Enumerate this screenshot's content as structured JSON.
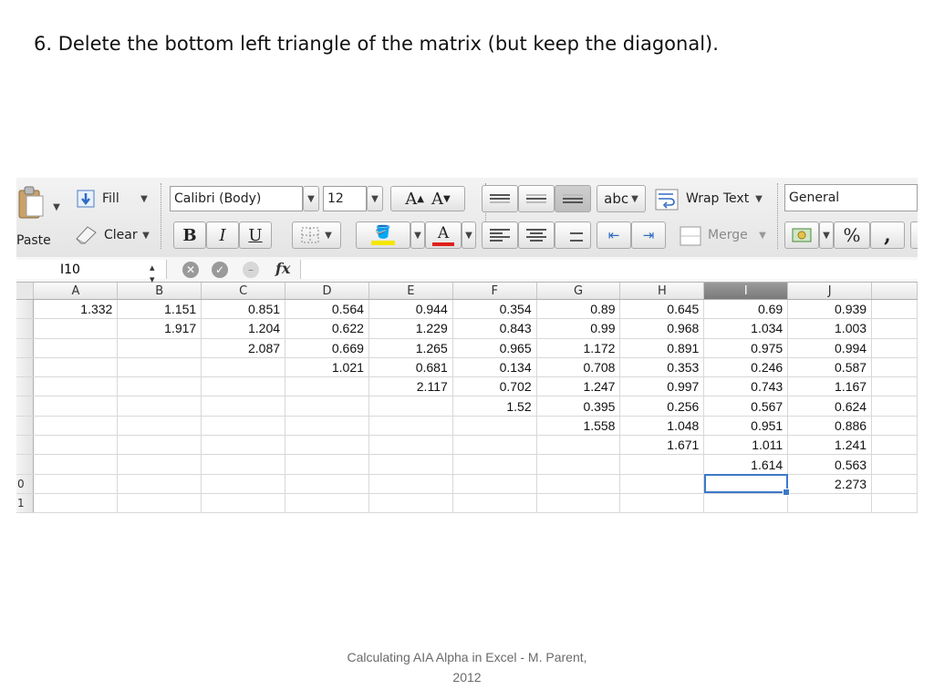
{
  "slide": {
    "title": "6. Delete the bottom left triangle of the matrix (but keep the diagonal).",
    "footer_line1": "Calculating AIA Alpha in Excel - M. Parent,",
    "footer_line2": "2012"
  },
  "ribbon": {
    "paste_label": "Paste",
    "fill_label": "Fill",
    "clear_label": "Clear",
    "font_name": "Calibri (Body)",
    "font_size": "12",
    "bold": "B",
    "italic": "I",
    "underline": "U",
    "grow_font": "A",
    "shrink_font": "A",
    "font_color_glyph": "A",
    "orientation_label": "abc",
    "wrap_text_label": "Wrap Text",
    "merge_label": "Merge",
    "number_format": "General",
    "percent": "%",
    "comma": ",",
    "fill_color": "#f5e600",
    "font_color": "#e0201a"
  },
  "formula_bar": {
    "name_box": "I10",
    "fx_label": "fx",
    "formula": ""
  },
  "sheet": {
    "columns": [
      "A",
      "B",
      "C",
      "D",
      "E",
      "F",
      "G",
      "H",
      "I",
      "J"
    ],
    "selected_column": "I",
    "active_cell": "I10",
    "row_labels": [
      "",
      "",
      "",
      "",
      "",
      "",
      "",
      "",
      "",
      "0",
      "1"
    ],
    "rows": [
      [
        "1.332",
        "1.151",
        "0.851",
        "0.564",
        "0.944",
        "0.354",
        "0.89",
        "0.645",
        "0.69",
        "0.939"
      ],
      [
        "",
        "1.917",
        "1.204",
        "0.622",
        "1.229",
        "0.843",
        "0.99",
        "0.968",
        "1.034",
        "1.003"
      ],
      [
        "",
        "",
        "2.087",
        "0.669",
        "1.265",
        "0.965",
        "1.172",
        "0.891",
        "0.975",
        "0.994"
      ],
      [
        "",
        "",
        "",
        "1.021",
        "0.681",
        "0.134",
        "0.708",
        "0.353",
        "0.246",
        "0.587"
      ],
      [
        "",
        "",
        "",
        "",
        "2.117",
        "0.702",
        "1.247",
        "0.997",
        "0.743",
        "1.167"
      ],
      [
        "",
        "",
        "",
        "",
        "",
        "1.52",
        "0.395",
        "0.256",
        "0.567",
        "0.624"
      ],
      [
        "",
        "",
        "",
        "",
        "",
        "",
        "1.558",
        "1.048",
        "0.951",
        "0.886"
      ],
      [
        "",
        "",
        "",
        "",
        "",
        "",
        "",
        "1.671",
        "1.011",
        "1.241"
      ],
      [
        "",
        "",
        "",
        "",
        "",
        "",
        "",
        "",
        "1.614",
        "0.563"
      ],
      [
        "",
        "",
        "",
        "",
        "",
        "",
        "",
        "",
        "",
        "2.273"
      ],
      [
        "",
        "",
        "",
        "",
        "",
        "",
        "",
        "",
        "",
        ""
      ]
    ]
  }
}
